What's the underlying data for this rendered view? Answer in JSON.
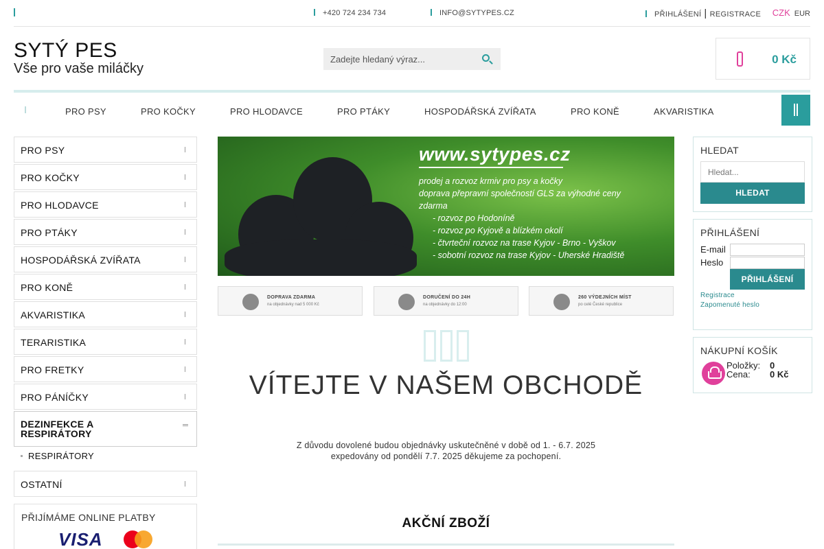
{
  "topbar": {
    "phone": "+420 724 234 734",
    "email": "INFO@SYTYPES.CZ",
    "login": "PŘIHLÁŠENÍ",
    "separator": "|",
    "register": "REGISTRACE",
    "currency_active": "CZK",
    "currency_other": "EUR"
  },
  "header": {
    "logo_title": "SYTÝ PES",
    "logo_subtitle": "Vše pro vaše miláčky",
    "search_placeholder": "Zadejte hledaný výraz...",
    "cart_total": "0 Kč"
  },
  "nav": {
    "items": [
      "PRO PSY",
      "PRO KOČKY",
      "PRO HLODAVCE",
      "PRO PTÁKY",
      "HOSPODÁŘSKÁ ZVÍŘATA",
      "PRO KONĚ",
      "AKVARISTIKA"
    ]
  },
  "sidebar": {
    "categories": [
      "PRO PSY",
      "PRO KOČKY",
      "PRO HLODAVCE",
      "PRO PTÁKY",
      "HOSPODÁŘSKÁ ZVÍŘATA",
      "PRO KONĚ",
      "AKVARISTIKA",
      "TERARISTIKA",
      "PRO FRETKY",
      "PRO PÁNÍČKY"
    ],
    "open_category": "DEZINFEKCE A RESPIRÁTORY",
    "subcategory": "RESPIRÁTORY",
    "last_category": "OSTATNÍ",
    "payments_title": "PŘIJÍMÁME ONLINE PLATBY",
    "visa": "VISA"
  },
  "banner": {
    "url": "www.sytypes.cz",
    "lines": [
      "prodej a rozvoz krmiv pro psy a kočky",
      "doprava přepravní společností GLS za výhodné ceny",
      "zdarma"
    ],
    "bullets": [
      "- rozvoz po Hodoníně",
      "- rozvoz po Kyjově a blízkém okolí",
      "- čtvrteční rozvoz na trase Kyjov - Brno - Vyškov",
      "- sobotní rozvoz na trase Kyjov - Uherské Hradiště"
    ]
  },
  "features": [
    {
      "title": "DOPRAVA ZDARMA",
      "sub": "na objednávky nad 5 000 Kč"
    },
    {
      "title": "DORUČENÍ DO 24H",
      "sub": "na objednávky do 12:00"
    },
    {
      "title": "260 VÝDEJNÍCH MÍST",
      "sub": "po celé České republice"
    }
  ],
  "main": {
    "welcome": "VÍTEJTE V NAŠEM OBCHODĚ",
    "notice_line1": "Z důvodu dovolené budou objednávky uskutečněné v době od 1. - 6.7. 2025",
    "notice_line2": "expedovány od pondělí 7.7. 2025 děkujeme za pochopení.",
    "featured_title": "AKČNÍ ZBOŽÍ"
  },
  "right": {
    "search_title": "HLEDAT",
    "search_placeholder": "Hledat...",
    "search_button": "HLEDAT",
    "login_title": "PŘIHLÁŠENÍ",
    "email_label": "E-mail",
    "password_label": "Heslo",
    "login_button": "PŘIHLÁŠENÍ",
    "register_link": "Registrace",
    "forgot_link": "Zapomenuté heslo",
    "cart_title": "NÁKUPNÍ KOŠÍK",
    "items_label": "Položky:",
    "items_value": "0",
    "price_label": "Cena:",
    "price_value": "0 Kč"
  },
  "colors": {
    "accent": "#2a9d9d",
    "button": "#2a8a8e",
    "pink": "#e0409b"
  }
}
